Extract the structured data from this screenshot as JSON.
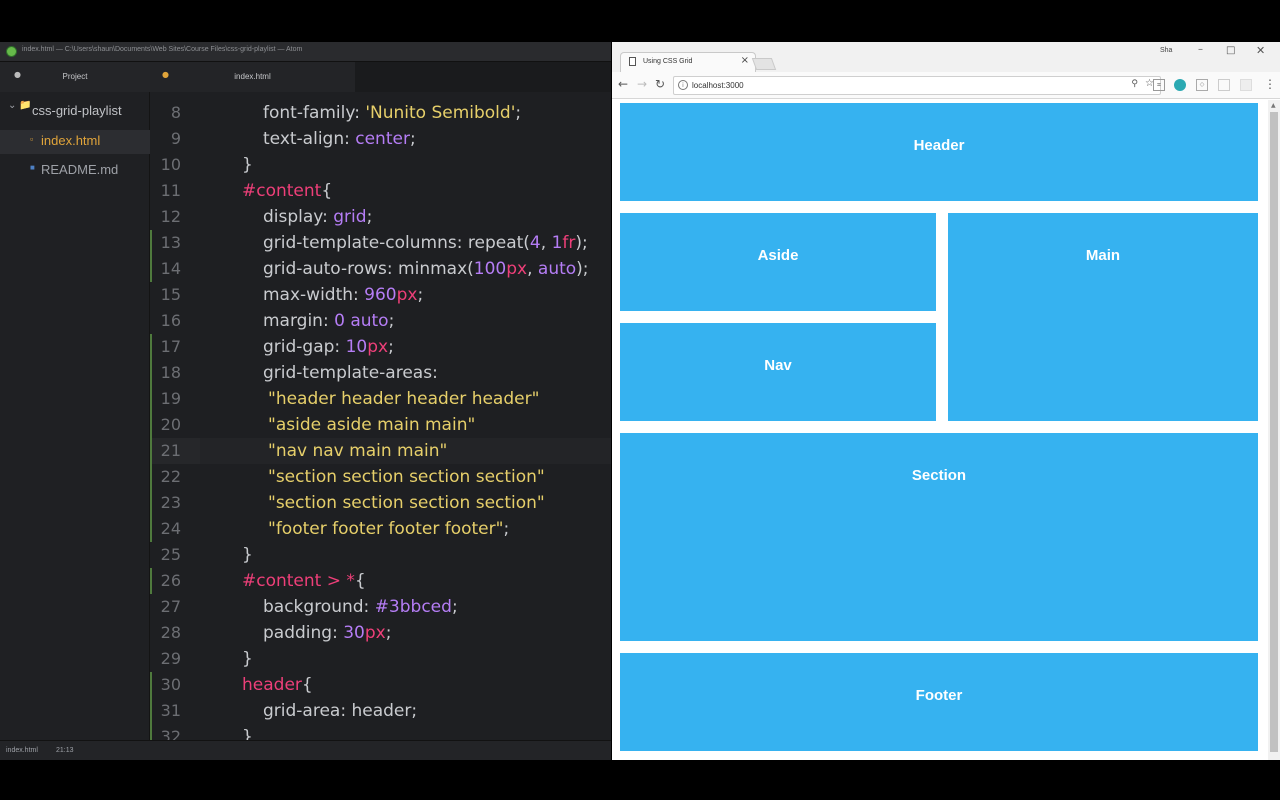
{
  "atom": {
    "window_title": "index.html — C:\\Users\\shaun\\Documents\\Web Sites\\Course Files\\css-grid-playlist — Atom",
    "tree_title": "Project",
    "tree": {
      "root": "css-grid-playlist",
      "files": [
        "index.html",
        "README.md"
      ]
    },
    "tab": "index.html",
    "status": {
      "file": "index.html",
      "cursor": "21:13"
    },
    "code": [
      {
        "n": "8",
        "indent": 1,
        "parts": [
          [
            "prop",
            "font-family: "
          ],
          [
            "str",
            "'Nunito Semibold'"
          ],
          [
            "punc",
            ";"
          ]
        ]
      },
      {
        "n": "9",
        "indent": 1,
        "parts": [
          [
            "prop",
            "text-align: "
          ],
          [
            "val",
            "center"
          ],
          [
            "punc",
            ";"
          ]
        ]
      },
      {
        "n": "10",
        "indent": 0,
        "parts": [
          [
            "punc",
            "}"
          ]
        ]
      },
      {
        "n": "11",
        "indent": 0,
        "parts": [
          [
            "sel",
            "#content"
          ],
          [
            "punc",
            "{"
          ]
        ]
      },
      {
        "n": "12",
        "indent": 1,
        "parts": [
          [
            "prop",
            "display: "
          ],
          [
            "val",
            "grid"
          ],
          [
            "punc",
            ";"
          ]
        ]
      },
      {
        "n": "13",
        "indent": 1,
        "parts": [
          [
            "prop",
            "grid-template-columns: repeat("
          ],
          [
            "num",
            "4"
          ],
          [
            "punc",
            ", "
          ],
          [
            "num",
            "1"
          ],
          [
            "unit",
            "fr"
          ],
          [
            "punc",
            ");"
          ]
        ]
      },
      {
        "n": "14",
        "indent": 1,
        "parts": [
          [
            "prop",
            "grid-auto-rows: minmax("
          ],
          [
            "num",
            "100"
          ],
          [
            "unit",
            "px"
          ],
          [
            "punc",
            ", "
          ],
          [
            "val",
            "auto"
          ],
          [
            "punc",
            ");"
          ]
        ]
      },
      {
        "n": "15",
        "indent": 1,
        "parts": [
          [
            "prop",
            "max-width: "
          ],
          [
            "num",
            "960"
          ],
          [
            "unit",
            "px"
          ],
          [
            "punc",
            ";"
          ]
        ]
      },
      {
        "n": "16",
        "indent": 1,
        "parts": [
          [
            "prop",
            "margin: "
          ],
          [
            "num",
            "0"
          ],
          [
            "punc",
            " "
          ],
          [
            "val",
            "auto"
          ],
          [
            "punc",
            ";"
          ]
        ]
      },
      {
        "n": "17",
        "indent": 1,
        "parts": [
          [
            "prop",
            "grid-gap: "
          ],
          [
            "num",
            "10"
          ],
          [
            "unit",
            "px"
          ],
          [
            "punc",
            ";"
          ]
        ]
      },
      {
        "n": "18",
        "indent": 1,
        "parts": [
          [
            "prop",
            "grid-template-areas:"
          ]
        ]
      },
      {
        "n": "19",
        "indent": 2,
        "parts": [
          [
            "str",
            "\"header header header header\""
          ]
        ]
      },
      {
        "n": "20",
        "indent": 2,
        "parts": [
          [
            "str",
            "\"aside aside main main\""
          ]
        ]
      },
      {
        "n": "21",
        "indent": 2,
        "parts": [
          [
            "str",
            "\"nav nav main main\""
          ]
        ]
      },
      {
        "n": "22",
        "indent": 2,
        "parts": [
          [
            "str",
            "\"section section section section\""
          ]
        ]
      },
      {
        "n": "23",
        "indent": 2,
        "parts": [
          [
            "str",
            "\"section section section section\""
          ]
        ]
      },
      {
        "n": "24",
        "indent": 2,
        "parts": [
          [
            "str",
            "\"footer footer footer footer\""
          ],
          [
            "punc",
            ";"
          ]
        ]
      },
      {
        "n": "25",
        "indent": 0,
        "parts": [
          [
            "punc",
            "}"
          ]
        ]
      },
      {
        "n": "26",
        "indent": 0,
        "parts": [
          [
            "sel",
            "#content > *"
          ],
          [
            "punc",
            "{"
          ]
        ]
      },
      {
        "n": "27",
        "indent": 1,
        "parts": [
          [
            "prop",
            "background: "
          ],
          [
            "val",
            "#3bbced"
          ],
          [
            "punc",
            ";"
          ]
        ]
      },
      {
        "n": "28",
        "indent": 1,
        "parts": [
          [
            "prop",
            "padding: "
          ],
          [
            "num",
            "30"
          ],
          [
            "unit",
            "px"
          ],
          [
            "punc",
            ";"
          ]
        ]
      },
      {
        "n": "29",
        "indent": 0,
        "parts": [
          [
            "punc",
            "}"
          ]
        ]
      },
      {
        "n": "30",
        "indent": 0,
        "parts": [
          [
            "sel",
            "header"
          ],
          [
            "punc",
            "{"
          ]
        ]
      },
      {
        "n": "31",
        "indent": 1,
        "parts": [
          [
            "prop",
            "grid-area: header;"
          ]
        ]
      },
      {
        "n": "32",
        "indent": 0,
        "parts": [
          [
            "punc",
            "}"
          ]
        ]
      }
    ],
    "current_line": "21",
    "modified_lines": [
      "13",
      "14",
      "17",
      "18",
      "19",
      "20",
      "21",
      "22",
      "23",
      "24",
      "26",
      "30",
      "31",
      "32"
    ]
  },
  "browser": {
    "tab_title": "Using CSS Grid",
    "tab_close": "×",
    "user": "Sha",
    "url": "localhost:3000",
    "grid": {
      "header": "Header",
      "aside": "Aside",
      "main": "Main",
      "nav": "Nav",
      "section": "Section",
      "footer": "Footer"
    },
    "colors": {
      "grid_bg": "#36b2f0"
    }
  }
}
